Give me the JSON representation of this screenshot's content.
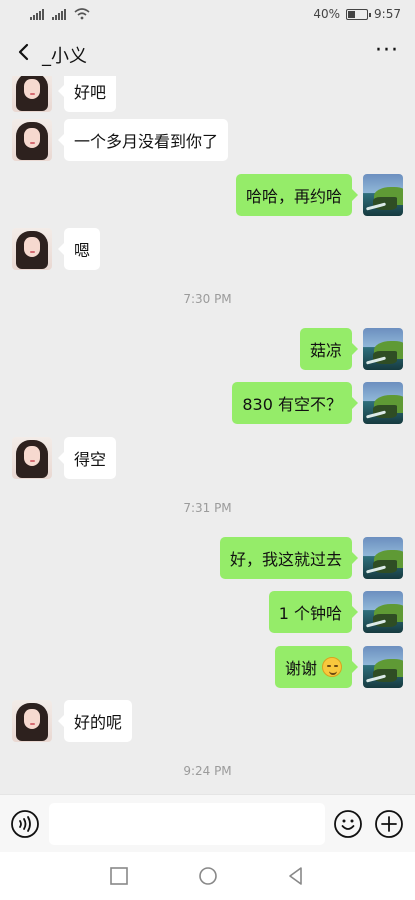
{
  "status": {
    "battery_percent": 40,
    "battery_text": "40%",
    "time": "9:57"
  },
  "header": {
    "title": "_小义",
    "back_icon": "chevron-left-icon",
    "more_icon": "more-dots-icon",
    "more_text": "···"
  },
  "chat": {
    "messages": [
      {
        "side": "left",
        "text": "好吧"
      },
      {
        "side": "left",
        "text": "一个多月没看到你了"
      },
      {
        "side": "right",
        "text": "哈哈，再约哈"
      },
      {
        "side": "left",
        "text": "嗯"
      },
      {
        "side": "time",
        "text": "7:30 PM"
      },
      {
        "side": "right",
        "text": "菇凉"
      },
      {
        "side": "right",
        "text": "830 有空不？"
      },
      {
        "side": "left",
        "text": "得空"
      },
      {
        "side": "time",
        "text": "7:31 PM"
      },
      {
        "side": "right",
        "text": "好，我这就过去"
      },
      {
        "side": "right",
        "text": "1 个钟哈"
      },
      {
        "side": "right",
        "text": "谢谢",
        "emoji": "blush-smile-emoji"
      },
      {
        "side": "left",
        "text": "好的呢"
      },
      {
        "side": "time",
        "text": "9:24 PM"
      }
    ]
  },
  "input": {
    "value": "",
    "placeholder": "",
    "voice_icon": "voice-icon",
    "emoji_icon": "emoji-icon",
    "add_icon": "plus-circle-icon"
  },
  "system_nav": {
    "recent_icon": "square-icon",
    "home_icon": "circle-icon",
    "back_icon": "triangle-back-icon"
  },
  "colors": {
    "background": "#ededed",
    "sent_bubble": "#95ec69",
    "received_bubble": "#ffffff",
    "timestamp": "#9b9b9b"
  }
}
